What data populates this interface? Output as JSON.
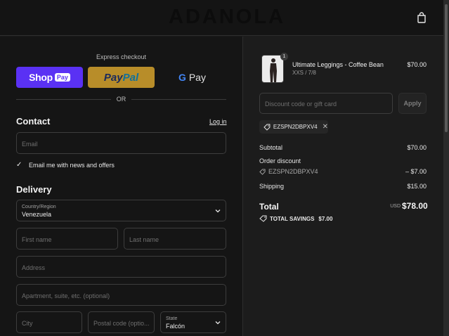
{
  "header": {
    "brand": "ADANOLA",
    "cart_icon": "shopping-bag-icon"
  },
  "express": {
    "label": "Express checkout",
    "shop_pay": {
      "name": "Shop",
      "badge": "Pay"
    },
    "paypal": {
      "part1": "Pay",
      "part2": "Pal"
    },
    "gpay": {
      "g": "G",
      "text": "Pay"
    },
    "or": "OR"
  },
  "contact": {
    "title": "Contact",
    "login": "Log in",
    "email_placeholder": "Email",
    "news_checkbox": "Email me with news and offers",
    "news_checked": true
  },
  "delivery": {
    "title": "Delivery",
    "country_label": "Country/Region",
    "country_value": "Venezuela",
    "first_name_placeholder": "First name",
    "last_name_placeholder": "Last name",
    "address_placeholder": "Address",
    "apartment_placeholder": "Apartment, suite, etc. (optional)",
    "city_placeholder": "City",
    "postal_placeholder": "Postal code (optio...",
    "state_label": "State",
    "state_value": "Falcón"
  },
  "order": {
    "product": {
      "name": "Ultimate Leggings - Coffee Bean",
      "variant": "XXS / 7/8",
      "price": "$70.00",
      "quantity": "1"
    },
    "discount_placeholder": "Discount code or gift card",
    "apply": "Apply",
    "applied_code": "EZSPN2DBPXV4",
    "subtotal_label": "Subtotal",
    "subtotal_value": "$70.00",
    "order_discount_label": "Order discount",
    "discount_code": "EZSPN2DBPXV4",
    "discount_value": "– $7.00",
    "shipping_label": "Shipping",
    "shipping_value": "$15.00",
    "total_label": "Total",
    "currency": "USD",
    "total_value": "$78.00",
    "savings_label": "TOTAL SAVINGS",
    "savings_value": "$7.00"
  }
}
